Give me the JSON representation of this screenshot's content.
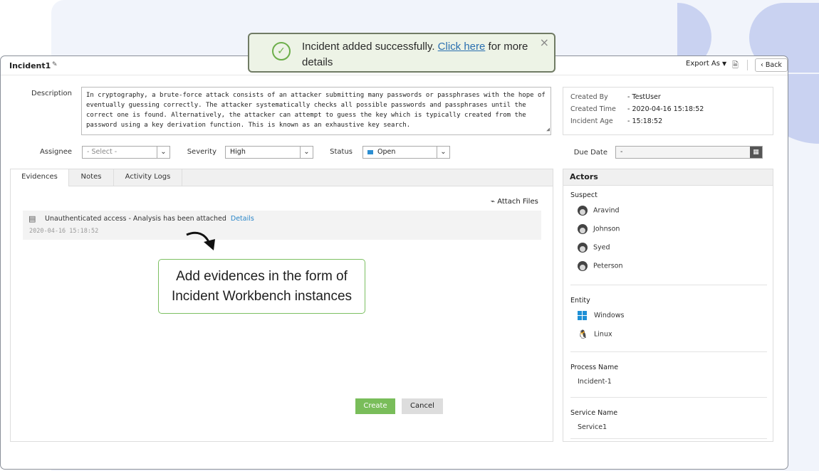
{
  "window": {
    "title": "Incident1",
    "export_label": "Export As",
    "back_label": "Back"
  },
  "toast": {
    "message_prefix": "Incident added successfully.",
    "link_text": "Click here",
    "message_suffix": "for more details",
    "close": "×"
  },
  "form": {
    "description_label": "Description",
    "description_text": "In cryptography, a brute-force attack consists of an attacker submitting many passwords or passphrases with the hope of eventually guessing correctly. The attacker systematically checks all possible passwords and passphrases until the correct one is found. Alternatively, the attacker can attempt to guess the key which is typically created from the password using a key derivation function. This is known as an exhaustive key search.",
    "assignee_label": "Assignee",
    "assignee_value": "- Select -",
    "severity_label": "Severity",
    "severity_value": "High",
    "status_label": "Status",
    "status_value": "Open",
    "status_color": "#2c8ed1",
    "due_date_label": "Due Date",
    "due_date_value": "-"
  },
  "meta": {
    "created_by_label": "Created By",
    "created_by_value": "- TestUser",
    "created_time_label": "Created Time",
    "created_time_value": "- 2020-04-16 15:18:52",
    "incident_age_label": "Incident Age",
    "incident_age_value": "- 15:18:52"
  },
  "tabs": [
    {
      "label": "Evidences"
    },
    {
      "label": "Notes"
    },
    {
      "label": "Activity Logs"
    }
  ],
  "evidences": {
    "attach_label": "Attach Files",
    "item_text": "Unauthenticated access - Analysis has been attached",
    "item_link": "Details",
    "item_date": "2020-04-16 15:18:52"
  },
  "callout": {
    "line1": "Add evidences in the form of",
    "line2": "Incident Workbench instances"
  },
  "actors": {
    "title": "Actors",
    "suspect_label": "Suspect",
    "suspects": [
      "Aravind",
      "Johnson",
      "Syed",
      "Peterson"
    ],
    "entity_label": "Entity",
    "entities": [
      "Windows",
      "Linux"
    ],
    "process_label": "Process Name",
    "process_value": "Incident-1",
    "service_label": "Service Name",
    "service_value": "Service1"
  },
  "buttons": {
    "create": "Create",
    "cancel": "Cancel"
  },
  "colors": {
    "accent_green": "#79bd5a",
    "link_blue": "#2a86c8",
    "decor": "#c9d2f1"
  }
}
